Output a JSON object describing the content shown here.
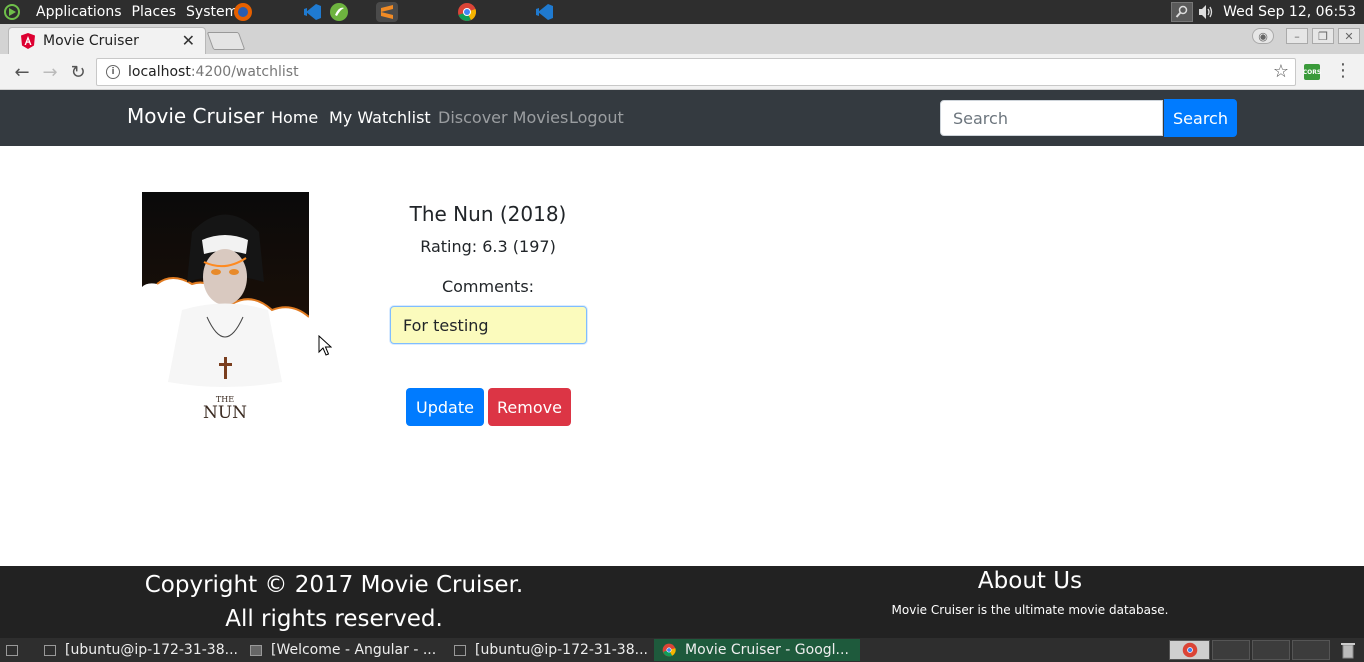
{
  "os_panel": {
    "menus": [
      "Applications",
      "Places",
      "System"
    ],
    "clock": "Wed Sep 12, 06:53"
  },
  "browser": {
    "tab_title": "Movie Cruiser",
    "url_host": "localhost",
    "url_rest": ":4200/watchlist",
    "extension_label": "CORS"
  },
  "navbar": {
    "brand": "Movie Cruiser",
    "links": [
      {
        "label": "Home"
      },
      {
        "label": "My Watchlist"
      },
      {
        "label": "Discover Movies"
      },
      {
        "label": "Logout"
      }
    ],
    "search_placeholder": "Search",
    "search_button": "Search"
  },
  "movie": {
    "title": "The Nun (2018)",
    "rating": "Rating: 6.3 (197)",
    "comments_label": "Comments:",
    "comments_value": "For testing",
    "poster_text_top": "THE",
    "poster_text_bottom": "NUN",
    "update_button": "Update",
    "remove_button": "Remove"
  },
  "footer": {
    "copyright_line1": "Copyright © 2017 Movie Cruiser.",
    "copyright_line2": "All rights reserved.",
    "about_title": "About Us",
    "about_text": "Movie Cruiser is the ultimate movie database."
  },
  "taskbar": {
    "tasks": [
      {
        "label": "[ubuntu@ip-172-31-38..."
      },
      {
        "label": "[Welcome - Angular - ..."
      },
      {
        "label": "[ubuntu@ip-172-31-38..."
      },
      {
        "label": "Movie Cruiser - Googl..."
      }
    ]
  },
  "colors": {
    "navbar_bg": "#343a40",
    "primary": "#007bff",
    "danger": "#dc3545",
    "footer_bg": "#222222"
  }
}
